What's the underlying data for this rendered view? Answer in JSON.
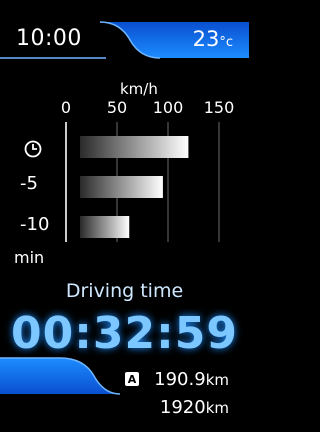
{
  "header": {
    "time": "10:00",
    "temperature": "23",
    "temperature_unit": "°c"
  },
  "chart_data": {
    "type": "bar",
    "orientation": "horizontal",
    "x_axis_label": "km/h",
    "x_ticks": [
      "0",
      "50",
      "100",
      "150"
    ],
    "xlim": [
      0,
      150
    ],
    "categories": [
      "current",
      "-5",
      "-10"
    ],
    "values": [
      120,
      95,
      62
    ],
    "y_unit_label": "min",
    "grid": true
  },
  "driving": {
    "label": "Driving time",
    "value": "00:32:59"
  },
  "trip": {
    "badge": "A",
    "distance1": "190.9",
    "unit1": "km",
    "distance2": "1920",
    "unit2": "km"
  },
  "colors": {
    "accent_blue": "#1f7fff",
    "value_blue": "#7cc7ff"
  },
  "icons": {
    "current_row_icon": "clock-icon"
  }
}
